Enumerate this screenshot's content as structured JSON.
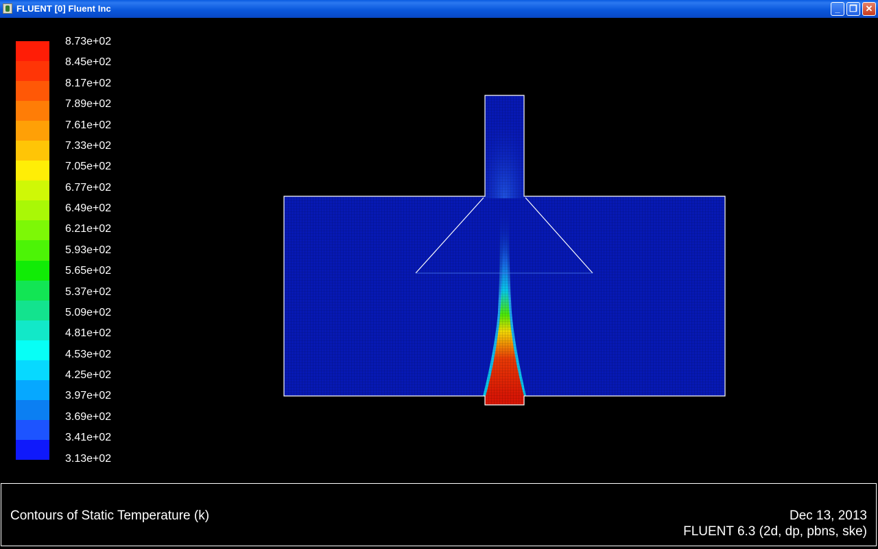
{
  "window": {
    "title": "FLUENT [0] Fluent Inc",
    "controls": [
      "minimize",
      "restore",
      "close"
    ]
  },
  "legend": {
    "labels": [
      "8.73e+02",
      "8.45e+02",
      "8.17e+02",
      "7.89e+02",
      "7.61e+02",
      "7.33e+02",
      "7.05e+02",
      "6.77e+02",
      "6.49e+02",
      "6.21e+02",
      "5.93e+02",
      "5.65e+02",
      "5.37e+02",
      "5.09e+02",
      "4.81e+02",
      "4.53e+02",
      "4.25e+02",
      "3.97e+02",
      "3.69e+02",
      "3.41e+02",
      "3.13e+02"
    ],
    "colors": [
      "#ff1d06",
      "#ff3506",
      "#ff5806",
      "#ff7d06",
      "#ffa006",
      "#ffc506",
      "#ffee06",
      "#cff806",
      "#a9f806",
      "#7df806",
      "#4cf406",
      "#11ec06",
      "#12e554",
      "#13e38e",
      "#12e8c8",
      "#07fff6",
      "#07d9ff",
      "#06a8ff",
      "#0b7ff2",
      "#1d54ff",
      "#0f19fb"
    ]
  },
  "contour": {
    "quantity": "Static Temperature",
    "units": "k",
    "min": 313,
    "max": 873,
    "background_color": "#0719b4",
    "hot_color": "#d81605"
  },
  "footer": {
    "caption": "Contours of Static Temperature (k)",
    "date": "Dec 13, 2013",
    "version": "FLUENT 6.3 (2d, dp, pbns, ske)"
  }
}
